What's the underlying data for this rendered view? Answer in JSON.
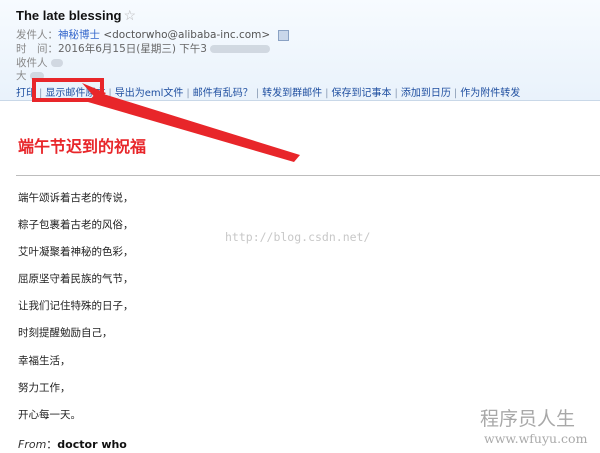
{
  "email": {
    "subject": "The late blessing",
    "star_glyph": "☆",
    "sender_label": "发件人：",
    "sender_name": "神秘博士",
    "sender_address": "<doctorwho@alibaba-inc.com>",
    "time_label": "时　间：",
    "time_value": "2016年6月15日(星期三) 下午3",
    "recipient_label": "收件人",
    "size_label": "大"
  },
  "toolbar": {
    "items": [
      "打印",
      "显示邮件原文",
      "导出为eml文件",
      "邮件有乱码？",
      "转发到群邮件",
      "保存到记事本",
      "添加到日历",
      "作为附件转发"
    ]
  },
  "body": {
    "title": "端午节迟到的祝福",
    "lines": [
      "端午颂诉着古老的传说，",
      "粽子包裹着古老的风俗，",
      "艾叶凝聚着神秘的色彩，",
      "屈原坚守着民族的气节，",
      "让我们记住特殊的日子，",
      "时刻提醒勉励自己，",
      "幸福生活，",
      "努力工作，",
      "开心每一天。"
    ],
    "from_label": "From",
    "from_sep": "：",
    "from_sender": "doctor who"
  },
  "watermark": {
    "url": "http://blog.csdn.net/",
    "site_name": "程序员人生",
    "site_url": "www.wfuyu.com"
  },
  "colors": {
    "highlight": "#e8262a",
    "link": "#1f4fa0"
  }
}
